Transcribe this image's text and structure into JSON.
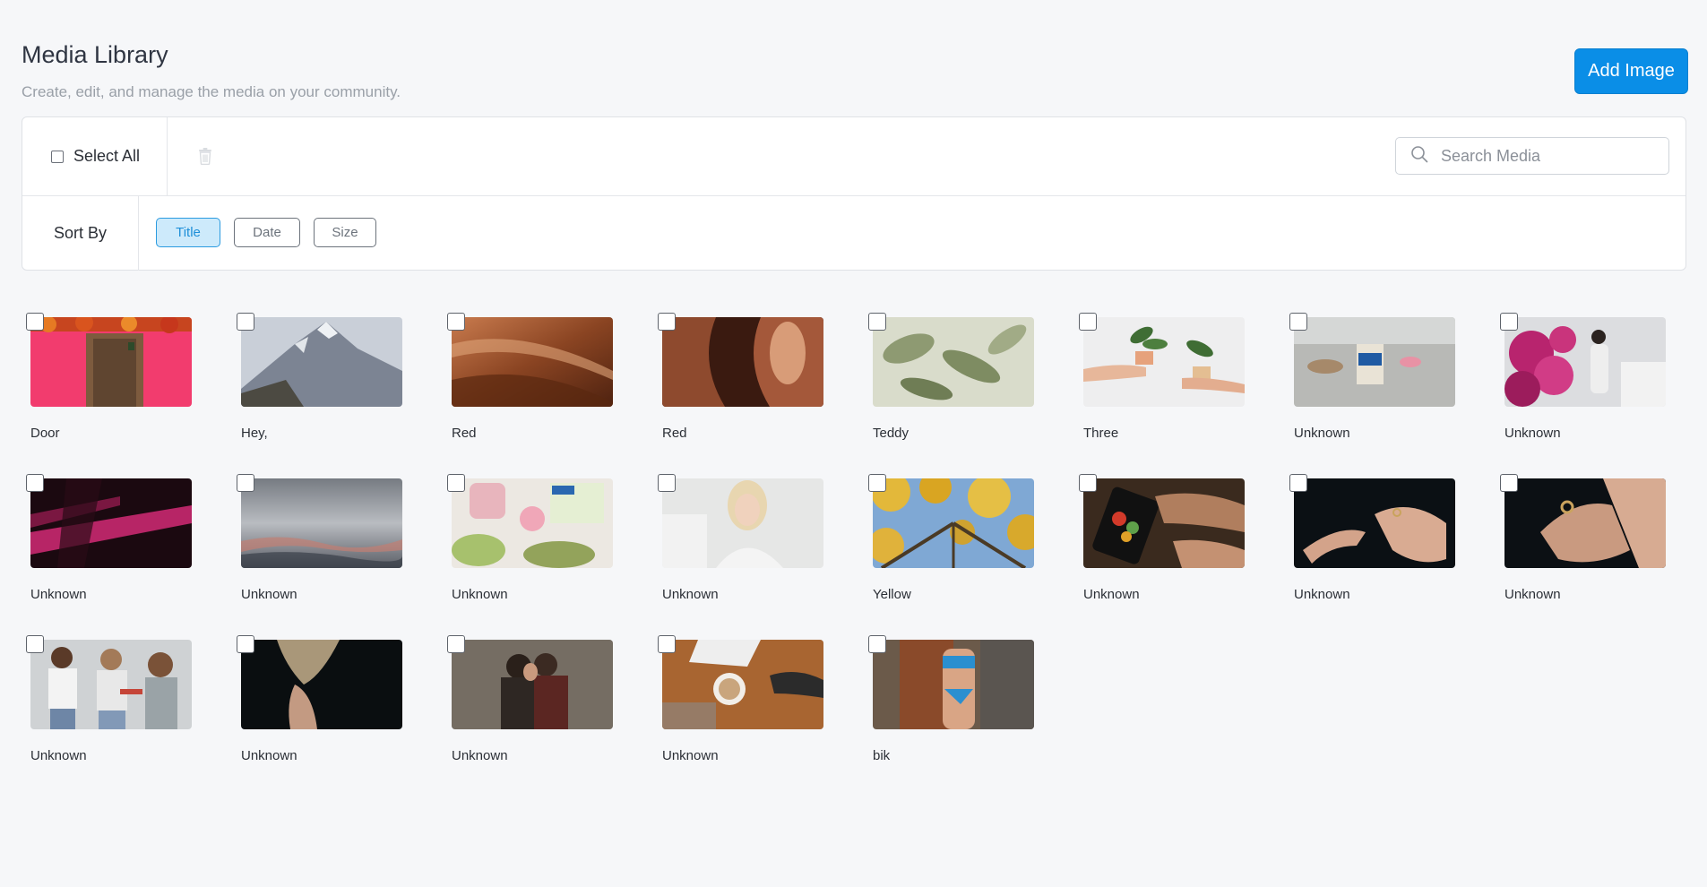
{
  "header": {
    "title": "Media Library",
    "subtitle": "Create, edit, and manage the media on your community.",
    "add_button_label": "Add Image"
  },
  "toolbar": {
    "select_all_label": "Select All",
    "search_placeholder": "Search Media",
    "sort_by_label": "Sort By",
    "sort_options": [
      "Title",
      "Date",
      "Size"
    ],
    "active_sort": "Title"
  },
  "colors": {
    "accent": "#0a8ee7",
    "background": "#f6f7f9",
    "active_sort_bg": "#cdeafb"
  },
  "icons": {
    "trash": "trash-icon",
    "search": "search-icon"
  },
  "media": [
    {
      "title": "Door"
    },
    {
      "title": "Hey,"
    },
    {
      "title": "Red"
    },
    {
      "title": "Red"
    },
    {
      "title": "Teddy"
    },
    {
      "title": "Three"
    },
    {
      "title": "Unknown"
    },
    {
      "title": "Unknown"
    },
    {
      "title": "Unknown"
    },
    {
      "title": "Unknown"
    },
    {
      "title": "Unknown"
    },
    {
      "title": "Unknown"
    },
    {
      "title": "Yellow"
    },
    {
      "title": "Unknown"
    },
    {
      "title": "Unknown"
    },
    {
      "title": "Unknown"
    },
    {
      "title": "Unknown"
    },
    {
      "title": "Unknown"
    },
    {
      "title": "Unknown"
    },
    {
      "title": "Unknown"
    },
    {
      "title": "bik"
    }
  ]
}
